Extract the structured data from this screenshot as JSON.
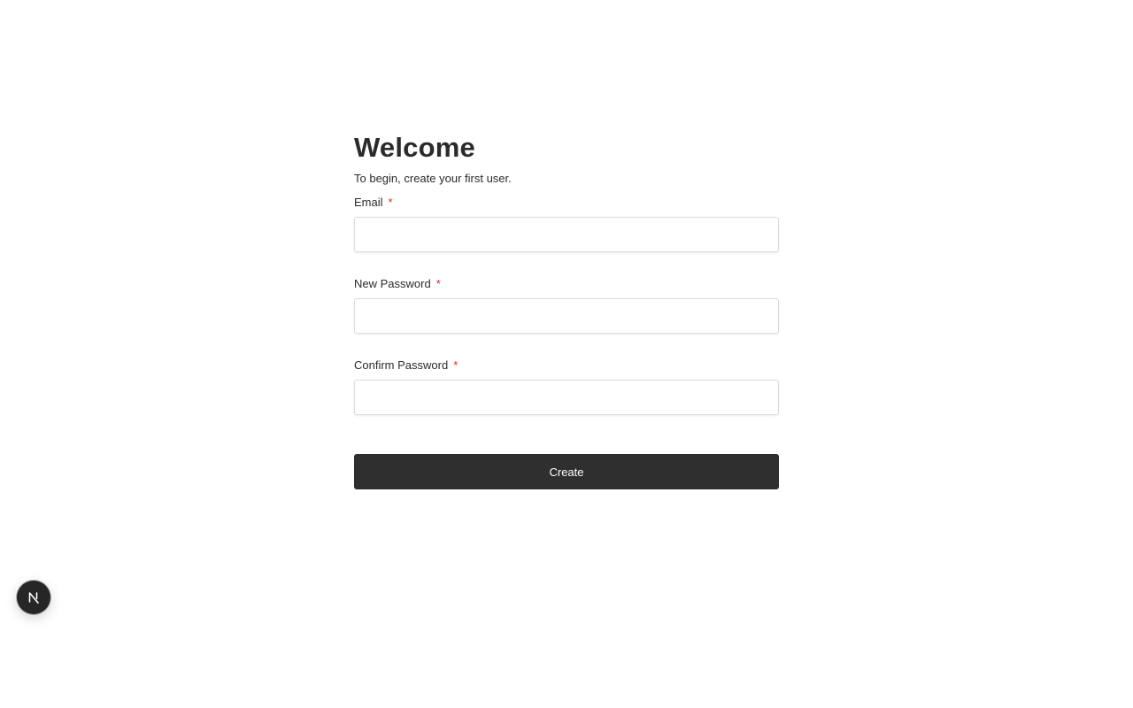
{
  "header": {
    "title": "Welcome",
    "subtitle": "To begin, create your first user."
  },
  "form": {
    "fields": [
      {
        "label": "Email",
        "required_mark": "*",
        "value": "",
        "placeholder": ""
      },
      {
        "label": "New Password",
        "required_mark": "*",
        "value": "",
        "placeholder": ""
      },
      {
        "label": "Confirm Password",
        "required_mark": "*",
        "value": "",
        "placeholder": ""
      }
    ],
    "submit_label": "Create"
  },
  "dev_badge": {
    "icon": "nextjs-icon"
  },
  "colors": {
    "button_bg": "#2f2f2f",
    "required": "#d92d20",
    "badge_bg": "#262626"
  }
}
